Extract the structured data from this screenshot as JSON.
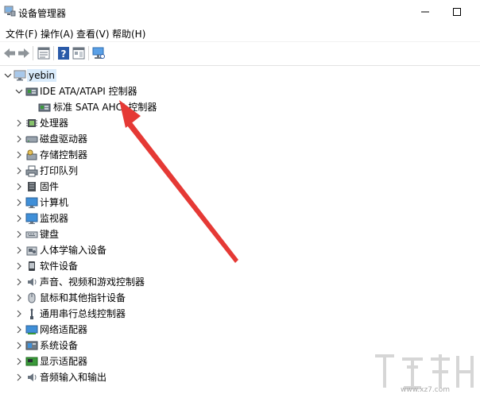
{
  "window": {
    "title": "设备管理器"
  },
  "menu": [
    {
      "label": "文件(F)"
    },
    {
      "label": "操作(A)"
    },
    {
      "label": "查看(V)"
    },
    {
      "label": "帮助(H)"
    }
  ],
  "toolbar": {
    "buttons": [
      {
        "icon": "back-arrow-icon"
      },
      {
        "icon": "forward-arrow-icon"
      },
      {
        "icon": "properties-icon"
      },
      {
        "icon": "help-icon"
      },
      {
        "icon": "view-icon"
      },
      {
        "icon": "scan-hardware-icon"
      }
    ]
  },
  "tree": {
    "root": {
      "label": "yebin",
      "icon": "computer-icon",
      "expanded": true
    },
    "expanded_category": {
      "label": "IDE ATA/ATAPI 控制器",
      "icon": "ide-controller-icon",
      "children": [
        {
          "label": "标准 SATA AHCI 控制器",
          "icon": "ide-controller-icon"
        }
      ]
    },
    "categories": [
      {
        "label": "处理器",
        "icon": "processor-icon"
      },
      {
        "label": "磁盘驱动器",
        "icon": "disk-drive-icon"
      },
      {
        "label": "存储控制器",
        "icon": "storage-controller-icon"
      },
      {
        "label": "打印队列",
        "icon": "printer-icon"
      },
      {
        "label": "固件",
        "icon": "firmware-icon"
      },
      {
        "label": "计算机",
        "icon": "monitor-icon"
      },
      {
        "label": "监视器",
        "icon": "monitor-icon"
      },
      {
        "label": "键盘",
        "icon": "keyboard-icon"
      },
      {
        "label": "人体学输入设备",
        "icon": "hid-icon"
      },
      {
        "label": "软件设备",
        "icon": "software-device-icon"
      },
      {
        "label": "声音、视频和游戏控制器",
        "icon": "speaker-icon"
      },
      {
        "label": "鼠标和其他指针设备",
        "icon": "mouse-icon"
      },
      {
        "label": "通用串行总线控制器",
        "icon": "usb-icon"
      },
      {
        "label": "网络适配器",
        "icon": "network-adapter-icon"
      },
      {
        "label": "系统设备",
        "icon": "system-device-icon"
      },
      {
        "label": "显示适配器",
        "icon": "display-adapter-icon"
      },
      {
        "label": "音频输入和输出",
        "icon": "audio-io-icon"
      }
    ]
  },
  "annotation": {
    "color": "#e53935"
  },
  "watermark": {
    "text": "www.xz7.com"
  }
}
